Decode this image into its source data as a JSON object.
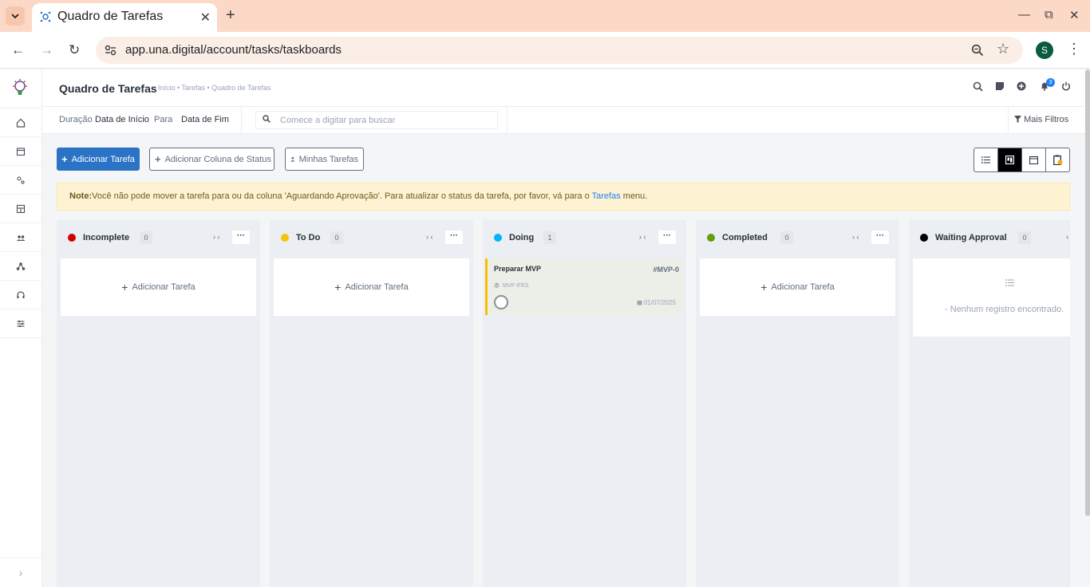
{
  "browser": {
    "tab_title": "Quadro de Tarefas",
    "url": "app.una.digital/account/tasks/taskboards",
    "profile_initial": "S"
  },
  "header": {
    "title": "Quadro de Tarefas",
    "breadcrumb": "Início • Tarefas • Quadro de Tarefas",
    "notification_count": "3"
  },
  "filters": {
    "duration_label": "Duração",
    "start_label": "Data de Início",
    "to_label": "Para",
    "end_label": "Data de Fim",
    "search_placeholder": "Comece a digitar para buscar",
    "more_filters": "Mais Filtros"
  },
  "actions": {
    "add_task": "Adicionar Tarefa",
    "add_status_column": "Adicionar Coluna de Status",
    "my_tasks": "Minhas Tarefas"
  },
  "note": {
    "label": "Note:",
    "text": "Você não pode mover a tarefa para ou da coluna 'Aguardando Aprovação'. Para atualizar o status da tarefa, por favor, vá para o",
    "link": "Tarefas",
    "suffix": "menu."
  },
  "columns": [
    {
      "title": "Incomplete",
      "count": "0",
      "color": "#d30000",
      "add_label": "Adicionar Tarefa"
    },
    {
      "title": "To Do",
      "count": "0",
      "color": "#f5c308",
      "add_label": "Adicionar Tarefa"
    },
    {
      "title": "Doing",
      "count": "1",
      "color": "#00b5ff"
    },
    {
      "title": "Completed",
      "count": "0",
      "color": "#679c0d",
      "add_label": "Adicionar Tarefa"
    },
    {
      "title": "Waiting Approval",
      "count": "0",
      "color": "#000000",
      "empty_text": "- Nenhum registro encontrado."
    }
  ],
  "task": {
    "title": "Preparar MVP",
    "code": "#MVP-0",
    "project": "MVP IFES",
    "date": "01/07/2025"
  },
  "colors": {
    "primary": "#2a73c5",
    "note_bg": "#fdf3d3",
    "link": "#1d82f5"
  }
}
